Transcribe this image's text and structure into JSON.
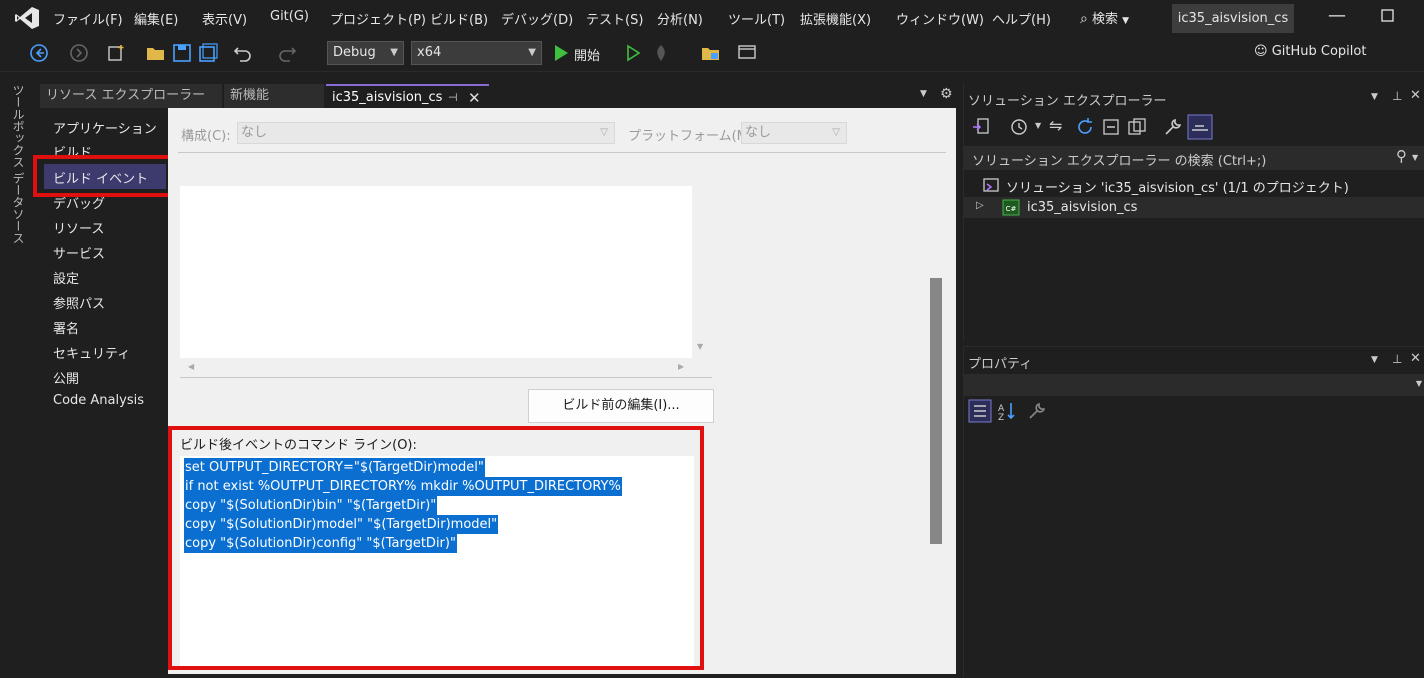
{
  "menu": {
    "items": [
      "ファイル(F)",
      "編集(E)",
      "表示(V)",
      "Git(G)",
      "プロジェクト(P)",
      "ビルド(B)",
      "デバッグ(D)",
      "テスト(S)",
      "分析(N)",
      "ツール(T)",
      "拡張機能(X)",
      "ウィンドウ(W)",
      "ヘルプ(H)"
    ],
    "search_label": "検索",
    "window_title": "ic35_aisvision_cs"
  },
  "toolbar": {
    "config": "Debug",
    "platform": "x64",
    "start_label": "開始",
    "copilot_label": "GitHub Copilot"
  },
  "left_strip": {
    "toolbox": "ツールボックス",
    "datasource": "データソース"
  },
  "doc_tabs": [
    {
      "label": "リソース エクスプローラー"
    },
    {
      "label": "新機能"
    },
    {
      "label": "ic35_aisvision_cs"
    }
  ],
  "nav": {
    "items": [
      "アプリケーション",
      "ビルド",
      "ビルド イベント",
      "デバッグ",
      "リソース",
      "サービス",
      "設定",
      "参照パス",
      "署名",
      "セキュリティ",
      "公開",
      "Code Analysis"
    ],
    "selected": "ビルド イベント"
  },
  "config_row": {
    "config_label": "構成(C):",
    "config_value": "なし",
    "platform_label": "プラットフォーム(M):",
    "platform_value": "なし"
  },
  "pre_build": {
    "edit_button": "ビルド前の編集(I)..."
  },
  "post_build": {
    "label": "ビルド後イベントのコマンド ライン(O):",
    "lines": [
      "set OUTPUT_DIRECTORY=\"$(TargetDir)model\"",
      "if not exist %OUTPUT_DIRECTORY% mkdir %OUTPUT_DIRECTORY%",
      "copy \"$(SolutionDir)bin\" \"$(TargetDir)\"",
      "copy \"$(SolutionDir)model\" \"$(TargetDir)model\"",
      "copy \"$(SolutionDir)config\" \"$(TargetDir)\""
    ]
  },
  "solution_explorer": {
    "title": "ソリューション エクスプローラー",
    "search": "ソリューション エクスプローラー の検索 (Ctrl+;)",
    "root": "ソリューション 'ic35_aisvision_cs' (1/1 のプロジェクト)",
    "project": "ic35_aisvision_cs"
  },
  "properties": {
    "title": "プロパティ"
  },
  "colors": {
    "accent": "#8a6cd6",
    "highlight": "#e01010",
    "selection": "#0a6fd0"
  }
}
